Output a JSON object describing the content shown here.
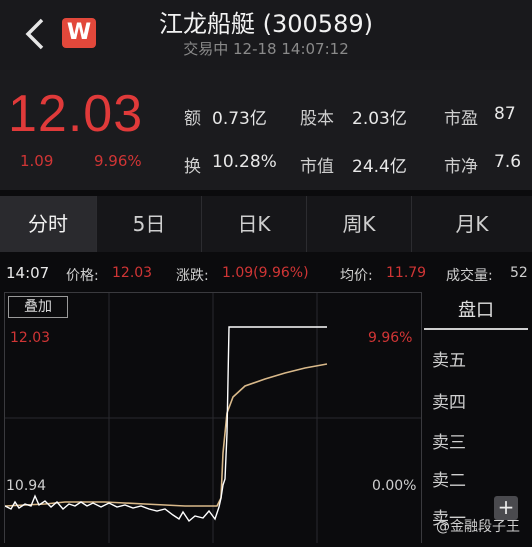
{
  "header": {
    "title": "江龙船艇 (300589)",
    "status": "交易中 12-18 14:07:12",
    "logo": "W"
  },
  "quote": {
    "price": "12.03",
    "change": "1.09",
    "change_pct": "9.96%",
    "stats": [
      {
        "label": "额",
        "value": "0.73亿"
      },
      {
        "label": "股本",
        "value": "2.03亿"
      },
      {
        "label": "市盈",
        "value": "87"
      },
      {
        "label": "换",
        "value": "10.28%"
      },
      {
        "label": "市值",
        "value": "24.4亿"
      },
      {
        "label": "市净",
        "value": "7.6"
      }
    ]
  },
  "tabs": [
    "分时",
    "5日",
    "日K",
    "周K",
    "月K"
  ],
  "info_row": {
    "time": "14:07",
    "price_label": "价格:",
    "price_value": "12.03",
    "change_label": "涨跌:",
    "change_value": "1.09(9.96%)",
    "avg_label": "均价:",
    "avg_value": "11.79",
    "volume_label": "成交量:",
    "volume_value": "52"
  },
  "chart": {
    "overlay_button": "叠加",
    "high_price": "12.03",
    "high_pct": "9.96%",
    "low_price": "10.94",
    "low_pct": "0.00%"
  },
  "order_book": {
    "title": "盘口",
    "rows": [
      "卖五",
      "卖四",
      "卖三",
      "卖二",
      "卖一"
    ]
  },
  "watermark": "@金融段子王",
  "colors": {
    "up": "#e03a3a",
    "price_line": "#ffffff",
    "avg_line": "#d9b98a"
  }
}
